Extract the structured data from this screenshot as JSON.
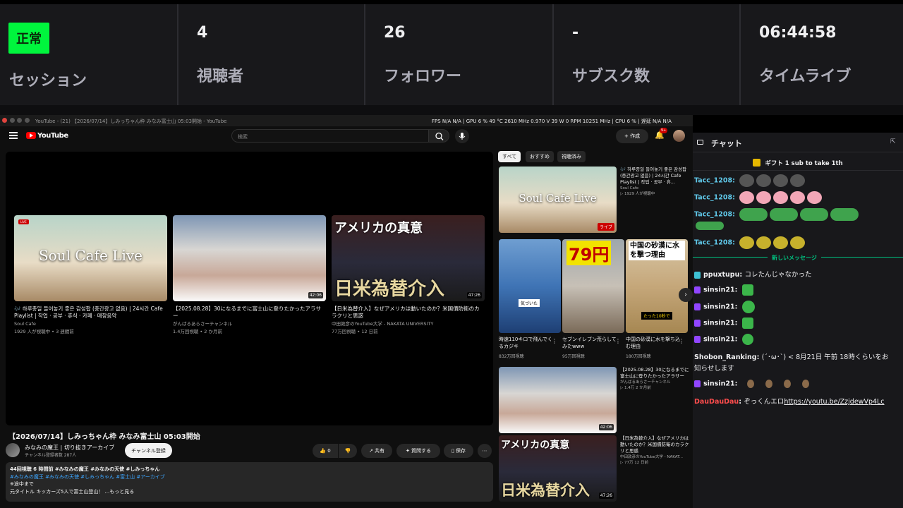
{
  "stats": [
    {
      "value": "正常",
      "label": "セッション"
    },
    {
      "value": "4",
      "label": "視聴者"
    },
    {
      "value": "26",
      "label": "フォロワー"
    },
    {
      "value": "-",
      "label": "サブスク数"
    },
    {
      "value": "06:44:58",
      "label": "タイムライブ"
    }
  ],
  "browser": {
    "tab_title": "YouTube - (21) 【2026/07/14】しみっちゃん枠 みなみ富士山 05:03開始 - YouTube",
    "perf": "FPS  N/A  N/A  |  GPU  6 %  49 °C  2610 MHz  0.970 V  39 W  0 RPM  10251 MHz  |  CPU  6 %  |  遅延  N/A  N/A",
    "logo": "YouTube",
    "search_placeholder": "検索",
    "create_label": "+ 作成",
    "bell_badge": "9+"
  },
  "player_cards": [
    {
      "title": "🎶 하루종일 들어놓기 좋은 감성팝 (중간광고 없음) | 24시간 Cafe Playlist | 작업 · 공부 · 휴식 · 카페 · 매장음악",
      "channel": "Soul Cafe",
      "meta": "1929 人が視聴中 • 3 週間前",
      "badge": "LIVE",
      "thumb_text": "Soul Cafe Live"
    },
    {
      "title": "【2025.08.28】30になるまでに富士山に登りたかったアラサー",
      "channel": "がんばるあらさーチャンネル",
      "meta": "1.4万回視聴 • 2 か月前",
      "duration": "42:06"
    },
    {
      "title": "【日米為替介入】なぜアメリカは動いたのか？米国債防衛のカラクリと思惑",
      "channel": "中田敦彦のYouTube大学 - NAKATA UNIVERSITY",
      "meta": "77万回視聴 • 12 日前",
      "duration": "47:26",
      "thumb_text_top": "アメリカの真意",
      "thumb_text_bottom": "日米為替介入"
    }
  ],
  "video": {
    "title": "【2026/07/14】しみっちゃん枠 みなみ富士山 05:03開始",
    "channel": "みなみの魔王 | 切り抜きアーカイブ",
    "subs": "チャンネル登録者数 287人",
    "subscribe": "チャンネル登録",
    "like": "0",
    "share": "共有",
    "ask": "質問する",
    "save": "保存",
    "desc_line1": "44回視聴  6 時間前  #みなみの魔王 #みなみの天使 #しみっちゃん",
    "desc_tags": "#みなみの魔王 #みなみの天使 #しみっちゃん #富士山 #アーカイブ",
    "desc_line3": "※途中まで",
    "desc_line4": "元タイトル キッカーズ5人で富士山登山！ ...もっと見る"
  },
  "chips": [
    "すべて",
    "おすすめ",
    "視聴済み"
  ],
  "recs": [
    {
      "title": "🎶 하루종일 들어놓기 좋은 감성팝 (중간광고 없음) | 24시간 Cafe Playlist | 작업 · 공부 · 휴...",
      "channel": "Soul Cafe",
      "meta": "▷ 1929 人が視聴中",
      "badge": "ライブ",
      "thumb_text": "Soul Cafe Live"
    },
    {
      "title": "【2025.08.28】30になるまでに富士山に登りたかったアラサー",
      "channel": "がんばるあらさーチャンネル",
      "meta": "▷ 1.4万  2 か月前",
      "duration": "42:06"
    },
    {
      "title": "【日米為替介入】なぜアメリカは動いたのか？米国債防衛のカラクリと思惑",
      "channel": "中田敦彦のYouTube大学 - NAKAT...",
      "meta": "▷ 77万  12 日前",
      "duration": "47:26",
      "thumb_text_top": "アメリカの真意",
      "thumb_text_bottom": "日米為替介入"
    }
  ],
  "shorts": [
    {
      "title": "時速110キロで飛んでくるカジキ",
      "views": "832万回視聴",
      "overlay": "気づいた"
    },
    {
      "title": "セブンイレブン荒らしてみたwww",
      "views": "95万回視聴",
      "overlay": "79円"
    },
    {
      "title": "中国の砂漠に水を撃ち込む理由",
      "views": "180万回視聴",
      "overlay": "中国の砂漠に水を撃つ理由",
      "overlay2": "たった10秒で"
    }
  ],
  "chat": {
    "title": "チャット",
    "gift": "ギフト 1 sub to take 1th",
    "new_messages": "新しいメッセージ",
    "messages": [
      {
        "user": "Tacc_1208",
        "color": "#5fc7e8",
        "text": ""
      },
      {
        "user": "Tacc_1208",
        "color": "#5fc7e8",
        "text": ""
      },
      {
        "user": "Tacc_1208",
        "color": "#5fc7e8",
        "text": ""
      },
      {
        "user": "Tacc_1208",
        "color": "#5fc7e8",
        "text": ""
      },
      {
        "user": "ppuxtupu",
        "color": "#efeff1",
        "text": "コレたんじゃなかった"
      },
      {
        "user": "sinsin21",
        "color": "#efeff1",
        "text": ""
      },
      {
        "user": "sinsin21",
        "color": "#efeff1",
        "text": ""
      },
      {
        "user": "sinsin21",
        "color": "#efeff1",
        "text": ""
      },
      {
        "user": "sinsin21",
        "color": "#efeff1",
        "text": ""
      },
      {
        "user": "Shobon_Ranking",
        "color": "#efeff1",
        "text": "(´･ω･`) < 8月21日 午前 18時くらいをお"
      },
      {
        "user": "",
        "color": "#efeff1",
        "text": "知らせします"
      },
      {
        "user": "sinsin21",
        "color": "#efeff1",
        "text": ""
      },
      {
        "user": "DauDauDau",
        "color": "#ff4d4d",
        "text": "ぞっくんエロ",
        "link": "https://youtu.be/ZzjdewVp4Lc"
      }
    ]
  }
}
